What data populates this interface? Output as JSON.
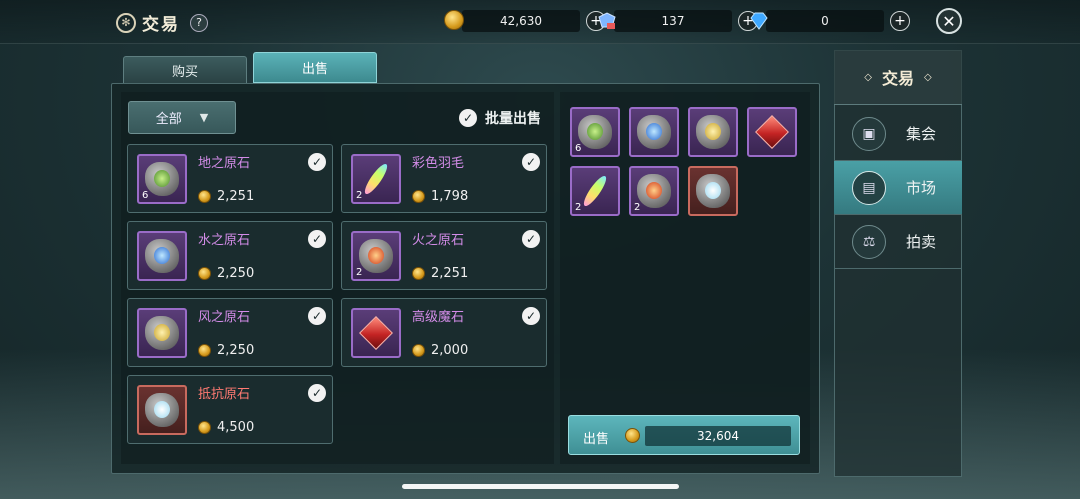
{
  "header": {
    "title": "交易",
    "help": "?",
    "gold": "42,630",
    "gems_blue": "137",
    "diamond": "0",
    "plus": "+",
    "close": "✕"
  },
  "tabs": {
    "buy": "购买",
    "sell": "出售"
  },
  "filter": {
    "label": "全部"
  },
  "bulk_sell": "批量出售",
  "items": [
    {
      "name": "地之原石",
      "qty": "6",
      "price": "2,251"
    },
    {
      "name": "彩色羽毛",
      "qty": "2",
      "price": "1,798"
    },
    {
      "name": "水之原石",
      "qty": "",
      "price": "2,250"
    },
    {
      "name": "火之原石",
      "qty": "2",
      "price": "2,251"
    },
    {
      "name": "风之原石",
      "qty": "",
      "price": "2,250"
    },
    {
      "name": "高级魔石",
      "qty": "",
      "price": "2,000"
    },
    {
      "name": "抵抗原石",
      "qty": "",
      "price": "4,500"
    }
  ],
  "selected_slots": [
    {
      "qty": "6"
    },
    {
      "qty": ""
    },
    {
      "qty": ""
    },
    {
      "qty": ""
    },
    {
      "qty": "2"
    },
    {
      "qty": "2"
    },
    {
      "qty": ""
    }
  ],
  "sell_button": {
    "label": "出售",
    "total": "32,604"
  },
  "nav": {
    "header": "交易",
    "items": [
      {
        "label": "集会"
      },
      {
        "label": "市场"
      },
      {
        "label": "拍卖"
      }
    ]
  },
  "colors": {
    "rare_name": "#d38ce8",
    "epic_name": "#ff7a72",
    "accent": "#4aa0a6"
  }
}
